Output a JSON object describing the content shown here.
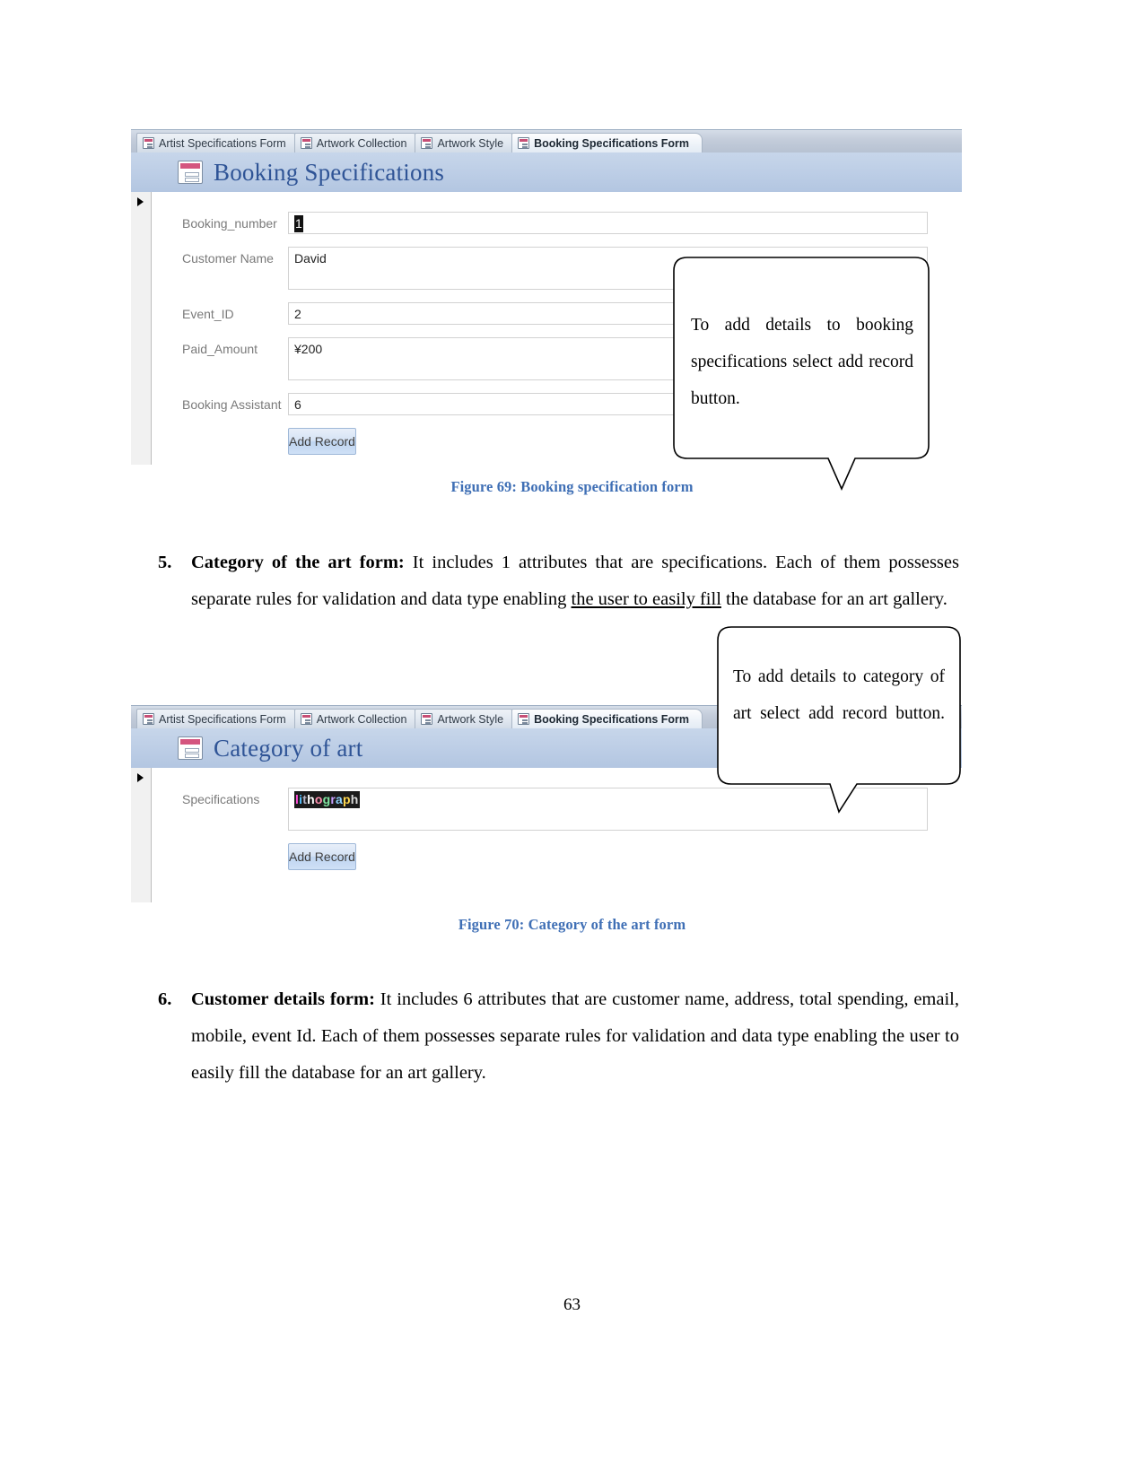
{
  "page": {
    "number": "63"
  },
  "figure1": {
    "tabs": [
      {
        "label": "Artist Specifications Form",
        "active": false
      },
      {
        "label": "Artwork Collection",
        "active": false
      },
      {
        "label": "Artwork Style",
        "active": false
      },
      {
        "label": "Booking Specifications Form",
        "active": true
      }
    ],
    "form_title": "Booking Specifications",
    "fields": [
      {
        "label": "Booking_number",
        "value": "1"
      },
      {
        "label": "Customer Name",
        "value": "David"
      },
      {
        "label": "Event_ID",
        "value": "2"
      },
      {
        "label": "Paid_Amount",
        "value": "¥200"
      },
      {
        "label": "Booking Assistant",
        "value": "6"
      }
    ],
    "add_record_label": "Add Record",
    "caption": "Figure 69: Booking specification form",
    "callout": "To add details to booking specifications select add record button."
  },
  "paragraph5": {
    "number": "5.",
    "heading": "Category of the art form:",
    "text_before_underline": " It includes 1 attributes that are specifications. Each of them possesses separate rules for validation and data type enabling ",
    "underlined": "the user to easily fill",
    "text_after_underline": " the database for an art gallery."
  },
  "figure2": {
    "tabs": [
      {
        "label": "Artist Specifications Form",
        "active": false
      },
      {
        "label": "Artwork Collection",
        "active": false
      },
      {
        "label": "Artwork Style",
        "active": false
      },
      {
        "label": "Booking Specifications Form",
        "active": true
      }
    ],
    "form_title": "Category of art",
    "fields": [
      {
        "label": "Specifications",
        "value": "lithograph"
      }
    ],
    "add_record_label": "Add Record",
    "caption": "Figure 70: Category of the art form",
    "callout": "To add details to category of art select add record button."
  },
  "paragraph6": {
    "number": "6.",
    "heading": "Customer details form:",
    "text": " It includes 6 attributes that are customer name, address, total spending, email, mobile, event Id. Each of them possesses separate rules for validation and data type enabling the user to easily fill the database for an art gallery."
  },
  "colors": {
    "caption_blue": "#3f6fb5",
    "form_title_blue": "#2f5496",
    "header_band": "#bdcee6",
    "button_blue": "#bed4f0"
  }
}
